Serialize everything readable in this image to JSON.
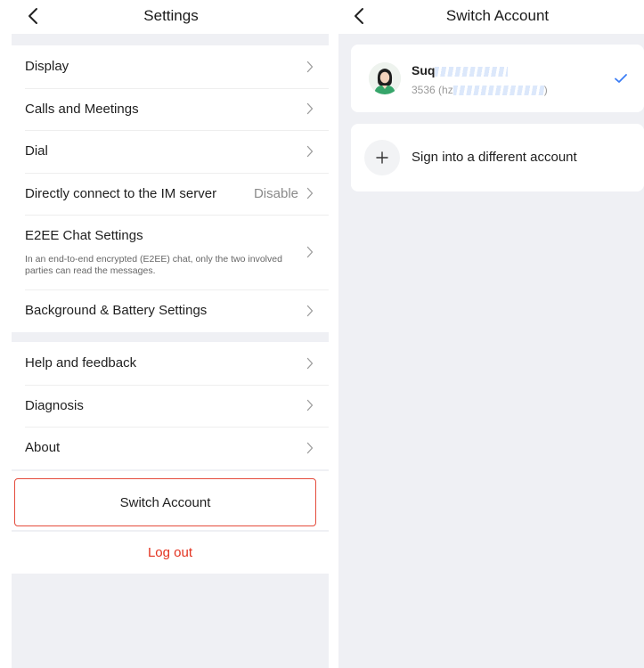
{
  "settings": {
    "title": "Settings",
    "group1": [
      {
        "label": "Display"
      },
      {
        "label": "Calls and Meetings"
      },
      {
        "label": "Dial"
      },
      {
        "label": "Directly connect to the IM server",
        "value": "Disable"
      },
      {
        "label": "E2EE Chat Settings",
        "description": "In an end-to-end encrypted (E2EE) chat, only the two involved parties can read the messages."
      },
      {
        "label": "Background & Battery Settings"
      }
    ],
    "group2": [
      {
        "label": "Help and feedback"
      },
      {
        "label": "Diagnosis"
      },
      {
        "label": "About"
      }
    ],
    "switch_account_label": "Switch Account",
    "logout_label": "Log out"
  },
  "switch_account": {
    "title": "Switch Account",
    "current_account": {
      "name_visible": "Suq",
      "name_masked": ":. '  ' '",
      "id_prefix": "3536 (hz",
      "id_suffix": ")",
      "selected": true
    },
    "add_account_label": "Sign into a different account"
  },
  "colors": {
    "accent_blue": "#3a7cf5",
    "danger_red": "#e3321f",
    "page_background": "#eff0f4"
  },
  "icons": [
    "back-arrow-icon",
    "chevron-right-icon",
    "checkmark-icon",
    "plus-icon",
    "avatar"
  ]
}
